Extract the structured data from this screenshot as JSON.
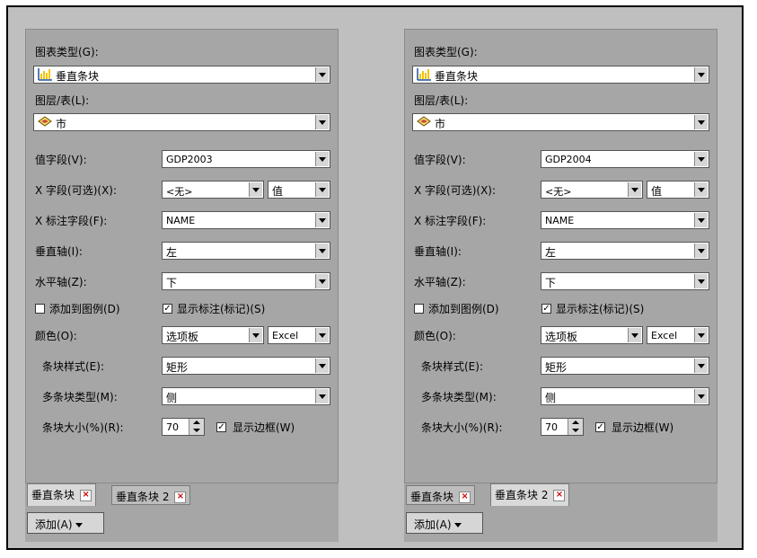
{
  "labels": {
    "chart_type": "图表类型(G):",
    "layer": "图层/表(L):",
    "value_field": "值字段(V):",
    "x_field": "X 字段(可选)(X):",
    "x_label_field": "X 标注字段(F):",
    "vertical_axis": "垂直轴(I):",
    "horizontal_axis": "水平轴(Z):",
    "add_to_legend": "添加到图例(D)",
    "show_labels": "显示标注(标记)(S)",
    "color": "颜色(O):",
    "bar_style": "条块样式(E):",
    "multi_bar_type": "多条块类型(M):",
    "bar_size": "条块大小(%)(R):",
    "show_border": "显示边框(W)",
    "add_button": "添加(A)"
  },
  "panels": [
    {
      "chart_type": "垂直条块",
      "layer": "市",
      "value_field": "GDP2003",
      "x_field": "<无>",
      "x_field_order": "值",
      "x_label_field": "NAME",
      "vertical_axis": "左",
      "horizontal_axis": "下",
      "add_to_legend": false,
      "show_labels": true,
      "color_scheme": "选项板",
      "palette": "Excel",
      "bar_style": "矩形",
      "multi_bar_type": "侧",
      "bar_size": "70",
      "show_border": true,
      "active_tab": 0,
      "tabs": [
        "垂直条块",
        "垂直条块 2"
      ]
    },
    {
      "chart_type": "垂直条块",
      "layer": "市",
      "value_field": "GDP2004",
      "x_field": "<无>",
      "x_field_order": "值",
      "x_label_field": "NAME",
      "vertical_axis": "左",
      "horizontal_axis": "下",
      "add_to_legend": false,
      "show_labels": true,
      "color_scheme": "选项板",
      "palette": "Excel",
      "bar_style": "矩形",
      "multi_bar_type": "侧",
      "bar_size": "70",
      "show_border": true,
      "active_tab": 1,
      "tabs": [
        "垂直条块",
        "垂直条块 2"
      ]
    }
  ],
  "icons": {
    "chart": "bar-chart-icon",
    "layer": "polygon-layer-icon",
    "close": "close-icon"
  },
  "colors": {
    "close_x": "#cc0000",
    "chart_icon_bars": "#f5c400",
    "chart_icon_axis": "#1f4fa0"
  }
}
